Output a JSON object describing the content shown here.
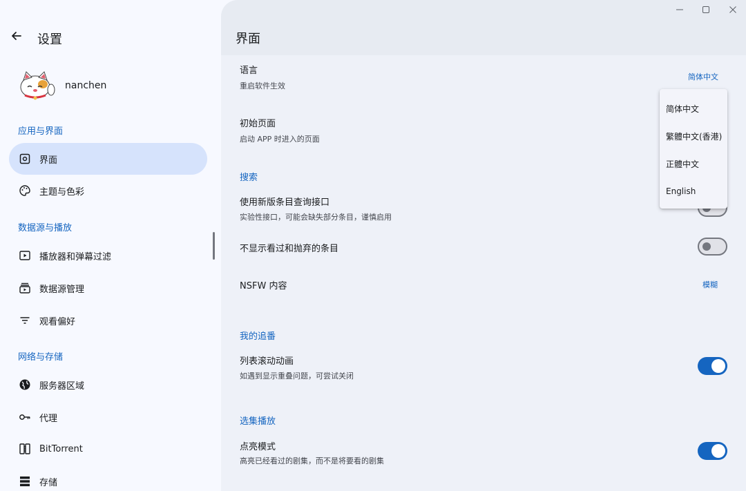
{
  "sidebar": {
    "title": "设置",
    "user": {
      "name": "nanchen"
    },
    "sections": [
      {
        "label": "应用与界面"
      },
      {
        "label": "数据源与播放"
      },
      {
        "label": "网络与存储"
      }
    ],
    "items": [
      {
        "label": "界面",
        "icon": "gear-square-icon",
        "active": true
      },
      {
        "label": "主题与色彩",
        "icon": "palette-icon"
      },
      {
        "label": "播放器和弹幕过滤",
        "icon": "play-box-icon"
      },
      {
        "label": "数据源管理",
        "icon": "stack-play-icon"
      },
      {
        "label": "观看偏好",
        "icon": "filter-lines-icon"
      },
      {
        "label": "服务器区域",
        "icon": "globe-icon"
      },
      {
        "label": "代理",
        "icon": "key-icon"
      },
      {
        "label": "BitTorrent",
        "icon": "bittorrent-icon"
      },
      {
        "label": "存储",
        "icon": "storage-icon"
      }
    ]
  },
  "main": {
    "title": "界面",
    "language": {
      "title": "语言",
      "subtitle": "重启软件生效",
      "value": "简体中文"
    },
    "start_page": {
      "title": "初始页面",
      "subtitle": "启动 APP 时进入的页面"
    },
    "search_group": "搜索",
    "new_api": {
      "title": "使用新版条目查询接口",
      "subtitle": "实验性接口，可能会缺失部分条目，谨慎启用",
      "enabled": false
    },
    "hide_watched": {
      "title": "不显示看过和抛弃的条目",
      "enabled": false
    },
    "nsfw": {
      "title": "NSFW 内容",
      "value": "模糊"
    },
    "following_group": "我的追番",
    "list_anim": {
      "title": "列表滚动动画",
      "subtitle": "如遇到显示重叠问题，可尝试关闭",
      "enabled": true
    },
    "episode_group": "选集播放",
    "highlight": {
      "title": "点亮模式",
      "subtitle": "高亮已经看过的剧集，而不是将要看的剧集",
      "enabled": true
    }
  },
  "language_dropdown": {
    "options": [
      "简体中文",
      "繁體中文(香港)",
      "正體中文",
      "English"
    ]
  },
  "window_controls": {
    "minimize": "minimize-icon",
    "maximize": "maximize-icon",
    "close": "close-icon"
  },
  "colors": {
    "accent": "#1565c0",
    "active_nav": "#d6e3fc",
    "panel": "#eef1f8"
  }
}
